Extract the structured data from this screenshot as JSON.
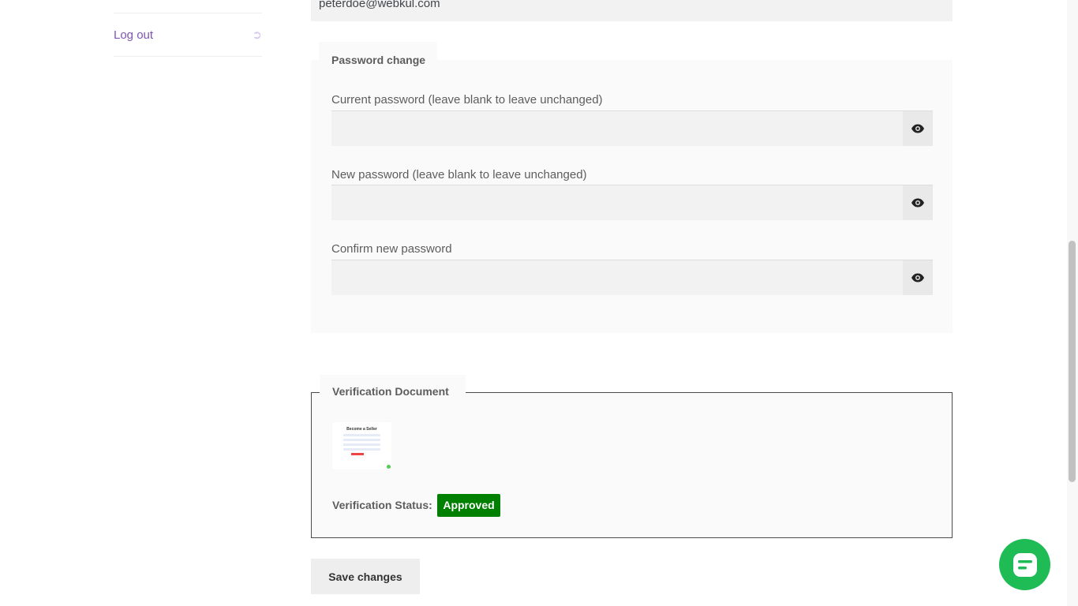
{
  "sidebar": {
    "logout_label": "Log out",
    "logout_icon": "sign-out-icon"
  },
  "account": {
    "email_value": "peterdoe@webkul.com"
  },
  "password_section": {
    "legend": "Password change",
    "fields": [
      {
        "label": "Current password (leave blank to leave unchanged)",
        "value": ""
      },
      {
        "label": "New password (leave blank to leave unchanged)",
        "value": ""
      },
      {
        "label": "Confirm new password",
        "value": ""
      }
    ],
    "toggle_icon": "eye-icon"
  },
  "verification": {
    "legend": "Verification Document",
    "thumbnail_title": "Become a Seller",
    "status_label": "Verification Status:",
    "status_value": "Approved",
    "status_color": "#008000"
  },
  "save_label": "Save changes",
  "chat_icon": "chat-icon",
  "colors": {
    "link": "#7f54b3",
    "chat": "#1fbb54"
  }
}
